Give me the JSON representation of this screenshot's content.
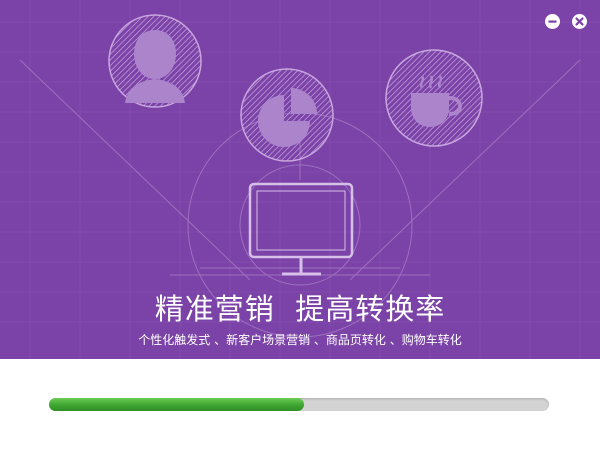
{
  "banner": {
    "background_color": "#7b42a7",
    "headline": "精准营销  提高转换率",
    "subline": "个性化触发式 、新客户场景营销 、商品页转化 、购物车转化"
  },
  "window_controls": {
    "minimize_icon": "minimize-icon",
    "close_icon": "close-icon"
  },
  "illustration_icons": [
    "person-icon",
    "pie-chart-icon",
    "coffee-cup-icon",
    "monitor-icon"
  ],
  "progress": {
    "fraction": 0.51,
    "fill_color": "#3fa531",
    "track_color": "#d3d3d3"
  }
}
